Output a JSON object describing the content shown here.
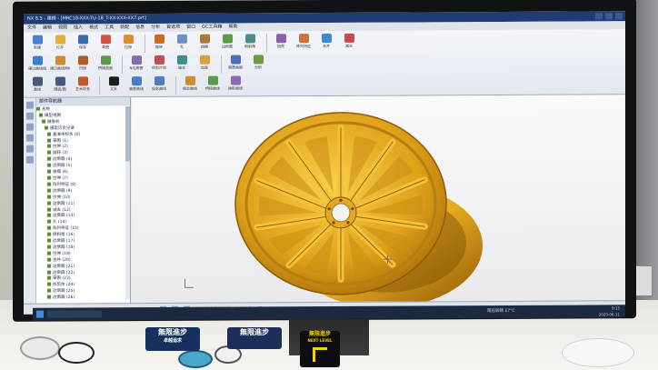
{
  "app": {
    "title": "NX 8.5 - 建模 - [MRC18-XXX-TU-18_T-XX-XXX-XX7.prt]",
    "menu": [
      "文件",
      "编辑",
      "视图",
      "插入",
      "格式",
      "工具",
      "装配",
      "信息",
      "分析",
      "首选项",
      "窗口",
      "GC工具箱",
      "帮助"
    ],
    "ribbon_row1": [
      {
        "label": "新建",
        "icon": "new-file-icon",
        "color": "#4a7fd6"
      },
      {
        "label": "打开",
        "icon": "open-folder-icon",
        "color": "#e3b13b"
      },
      {
        "label": "保存",
        "icon": "save-icon",
        "color": "#3c66b2"
      },
      {
        "label": "草图",
        "icon": "sketch-icon",
        "color": "#d8523a"
      },
      {
        "label": "拉伸",
        "icon": "extrude-icon",
        "color": "#e08a2c"
      },
      {
        "label": "旋转",
        "icon": "revolve-icon",
        "color": "#c96a1c"
      },
      {
        "label": "孔",
        "icon": "hole-icon",
        "color": "#6a8fc2"
      },
      {
        "label": "拔模",
        "icon": "draft-icon",
        "color": "#a77c3a"
      },
      {
        "label": "边倒圆",
        "icon": "edge-blend-icon",
        "color": "#5e9c49"
      },
      {
        "label": "倒斜角",
        "icon": "chamfer-icon",
        "color": "#4f8c8c"
      },
      {
        "label": "抽壳",
        "icon": "shell-icon",
        "color": "#8c5fb1"
      },
      {
        "label": "阵列特征",
        "icon": "pattern-icon",
        "color": "#d36e3a"
      },
      {
        "label": "合并",
        "icon": "unite-icon",
        "color": "#3a8ad1"
      },
      {
        "label": "减去",
        "icon": "subtract-icon",
        "color": "#c94a4a"
      }
    ],
    "ribbon_row2": [
      {
        "label": "通过曲线组",
        "icon": "loft-icon",
        "color": "#3a7ed0"
      },
      {
        "label": "通过曲线网格",
        "icon": "mesh-surface-icon",
        "color": "#d08b2e"
      },
      {
        "label": "扫掠",
        "icon": "sweep-icon",
        "color": "#b35a2a"
      },
      {
        "label": "桥接曲面",
        "icon": "bridge-icon",
        "color": "#5a9a4a"
      },
      {
        "label": "N边曲面",
        "icon": "n-sided-icon",
        "color": "#8a6ab0"
      },
      {
        "label": "修剪片体",
        "icon": "trim-sheet-icon",
        "color": "#c24f4f"
      },
      {
        "label": "缝合",
        "icon": "sew-icon",
        "color": "#3f8c8c"
      },
      {
        "label": "加厚",
        "icon": "thicken-icon",
        "color": "#d4a13a"
      },
      {
        "label": "偏置曲面",
        "icon": "offset-surface-icon",
        "color": "#4b6fb8"
      },
      {
        "label": "分析",
        "icon": "analysis-icon",
        "color": "#6b9c3c"
      }
    ],
    "ribbon_row3": [
      {
        "label": "直线",
        "icon": "line-icon",
        "color": "#475a7a"
      },
      {
        "label": "圆弧/圆",
        "icon": "arc-icon",
        "color": "#475a7a"
      },
      {
        "label": "艺术样条",
        "icon": "spline-icon",
        "color": "#c4572e"
      },
      {
        "label": "文本",
        "icon": "text-icon",
        "color": "#1d1d1d"
      },
      {
        "label": "偏置曲线",
        "icon": "offset-curve-icon",
        "color": "#4d7cc4"
      },
      {
        "label": "投影曲线",
        "icon": "project-curve-icon",
        "color": "#4d7cc4"
      },
      {
        "label": "相交曲线",
        "icon": "intersect-curve-icon",
        "color": "#d08b2e"
      },
      {
        "label": "桥接曲线",
        "icon": "bridge-curve-icon",
        "color": "#5a9a4a"
      },
      {
        "label": "抽取曲线",
        "icon": "extract-curve-icon",
        "color": "#8a6ab0"
      }
    ],
    "tree": {
      "header": "部件导航器",
      "rows": [
        "名称",
        "模型视图",
        "摄像机",
        "模型历史记录",
        "基准坐标系 (0)",
        "草图 (1)",
        "拉伸 (2)",
        "旋转 (3)",
        "边倒圆 (4)",
        "边倒圆 (5)",
        "拔模 (6)",
        "拉伸 (7)",
        "阵列特征 (8)",
        "边倒圆 (9)",
        "拉伸 (10)",
        "边倒圆 (11)",
        "减去 (12)",
        "边倒圆 (13)",
        "孔 (14)",
        "阵列特征 (15)",
        "倒斜角 (16)",
        "边倒圆 (17)",
        "边倒圆 (18)",
        "拉伸 (19)",
        "合并 (20)",
        "边倒圆 (21)",
        "边倒圆 (22)",
        "草图 (23)",
        "修剪体 (24)",
        "边倒圆 (25)",
        "边倒圆 (26)",
        "边倒圆 (27)",
        "边倒圆 (28)",
        "边倒圆 (29)",
        "偏置面 (30)",
        "边倒圆 (31)"
      ]
    },
    "viewport": {
      "wheel_color": "#e0a21a",
      "wheel_shadow": "#a86d07",
      "background": "#f2f2f3",
      "spoke_count": 10
    },
    "cmdbar_label": "选择对象并使用 MB3，或者双击某一对象"
  },
  "taskbar": {
    "weather": "雨后转晴",
    "temp": "17°C",
    "time": "9:15",
    "date": "2023-06-11"
  },
  "stickers": {
    "brand1_line1": "無限進步",
    "brand1_line2": "卓越追求",
    "brand2": "無限進步",
    "brand3": "無限進步",
    "brand3_sub": "NEXT LEVEL"
  }
}
